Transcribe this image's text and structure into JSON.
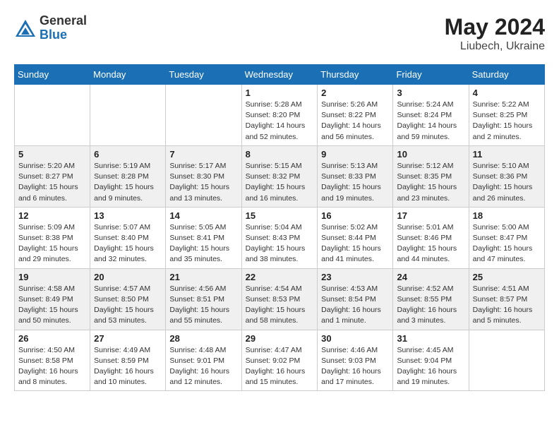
{
  "header": {
    "logo_general": "General",
    "logo_blue": "Blue",
    "month_year": "May 2024",
    "location": "Liubech, Ukraine"
  },
  "weekdays": [
    "Sunday",
    "Monday",
    "Tuesday",
    "Wednesday",
    "Thursday",
    "Friday",
    "Saturday"
  ],
  "weeks": [
    [
      {
        "day": "",
        "info": ""
      },
      {
        "day": "",
        "info": ""
      },
      {
        "day": "",
        "info": ""
      },
      {
        "day": "1",
        "info": "Sunrise: 5:28 AM\nSunset: 8:20 PM\nDaylight: 14 hours\nand 52 minutes."
      },
      {
        "day": "2",
        "info": "Sunrise: 5:26 AM\nSunset: 8:22 PM\nDaylight: 14 hours\nand 56 minutes."
      },
      {
        "day": "3",
        "info": "Sunrise: 5:24 AM\nSunset: 8:24 PM\nDaylight: 14 hours\nand 59 minutes."
      },
      {
        "day": "4",
        "info": "Sunrise: 5:22 AM\nSunset: 8:25 PM\nDaylight: 15 hours\nand 2 minutes."
      }
    ],
    [
      {
        "day": "5",
        "info": "Sunrise: 5:20 AM\nSunset: 8:27 PM\nDaylight: 15 hours\nand 6 minutes."
      },
      {
        "day": "6",
        "info": "Sunrise: 5:19 AM\nSunset: 8:28 PM\nDaylight: 15 hours\nand 9 minutes."
      },
      {
        "day": "7",
        "info": "Sunrise: 5:17 AM\nSunset: 8:30 PM\nDaylight: 15 hours\nand 13 minutes."
      },
      {
        "day": "8",
        "info": "Sunrise: 5:15 AM\nSunset: 8:32 PM\nDaylight: 15 hours\nand 16 minutes."
      },
      {
        "day": "9",
        "info": "Sunrise: 5:13 AM\nSunset: 8:33 PM\nDaylight: 15 hours\nand 19 minutes."
      },
      {
        "day": "10",
        "info": "Sunrise: 5:12 AM\nSunset: 8:35 PM\nDaylight: 15 hours\nand 23 minutes."
      },
      {
        "day": "11",
        "info": "Sunrise: 5:10 AM\nSunset: 8:36 PM\nDaylight: 15 hours\nand 26 minutes."
      }
    ],
    [
      {
        "day": "12",
        "info": "Sunrise: 5:09 AM\nSunset: 8:38 PM\nDaylight: 15 hours\nand 29 minutes."
      },
      {
        "day": "13",
        "info": "Sunrise: 5:07 AM\nSunset: 8:40 PM\nDaylight: 15 hours\nand 32 minutes."
      },
      {
        "day": "14",
        "info": "Sunrise: 5:05 AM\nSunset: 8:41 PM\nDaylight: 15 hours\nand 35 minutes."
      },
      {
        "day": "15",
        "info": "Sunrise: 5:04 AM\nSunset: 8:43 PM\nDaylight: 15 hours\nand 38 minutes."
      },
      {
        "day": "16",
        "info": "Sunrise: 5:02 AM\nSunset: 8:44 PM\nDaylight: 15 hours\nand 41 minutes."
      },
      {
        "day": "17",
        "info": "Sunrise: 5:01 AM\nSunset: 8:46 PM\nDaylight: 15 hours\nand 44 minutes."
      },
      {
        "day": "18",
        "info": "Sunrise: 5:00 AM\nSunset: 8:47 PM\nDaylight: 15 hours\nand 47 minutes."
      }
    ],
    [
      {
        "day": "19",
        "info": "Sunrise: 4:58 AM\nSunset: 8:49 PM\nDaylight: 15 hours\nand 50 minutes."
      },
      {
        "day": "20",
        "info": "Sunrise: 4:57 AM\nSunset: 8:50 PM\nDaylight: 15 hours\nand 53 minutes."
      },
      {
        "day": "21",
        "info": "Sunrise: 4:56 AM\nSunset: 8:51 PM\nDaylight: 15 hours\nand 55 minutes."
      },
      {
        "day": "22",
        "info": "Sunrise: 4:54 AM\nSunset: 8:53 PM\nDaylight: 15 hours\nand 58 minutes."
      },
      {
        "day": "23",
        "info": "Sunrise: 4:53 AM\nSunset: 8:54 PM\nDaylight: 16 hours\nand 1 minute."
      },
      {
        "day": "24",
        "info": "Sunrise: 4:52 AM\nSunset: 8:55 PM\nDaylight: 16 hours\nand 3 minutes."
      },
      {
        "day": "25",
        "info": "Sunrise: 4:51 AM\nSunset: 8:57 PM\nDaylight: 16 hours\nand 5 minutes."
      }
    ],
    [
      {
        "day": "26",
        "info": "Sunrise: 4:50 AM\nSunset: 8:58 PM\nDaylight: 16 hours\nand 8 minutes."
      },
      {
        "day": "27",
        "info": "Sunrise: 4:49 AM\nSunset: 8:59 PM\nDaylight: 16 hours\nand 10 minutes."
      },
      {
        "day": "28",
        "info": "Sunrise: 4:48 AM\nSunset: 9:01 PM\nDaylight: 16 hours\nand 12 minutes."
      },
      {
        "day": "29",
        "info": "Sunrise: 4:47 AM\nSunset: 9:02 PM\nDaylight: 16 hours\nand 15 minutes."
      },
      {
        "day": "30",
        "info": "Sunrise: 4:46 AM\nSunset: 9:03 PM\nDaylight: 16 hours\nand 17 minutes."
      },
      {
        "day": "31",
        "info": "Sunrise: 4:45 AM\nSunset: 9:04 PM\nDaylight: 16 hours\nand 19 minutes."
      },
      {
        "day": "",
        "info": ""
      }
    ]
  ]
}
